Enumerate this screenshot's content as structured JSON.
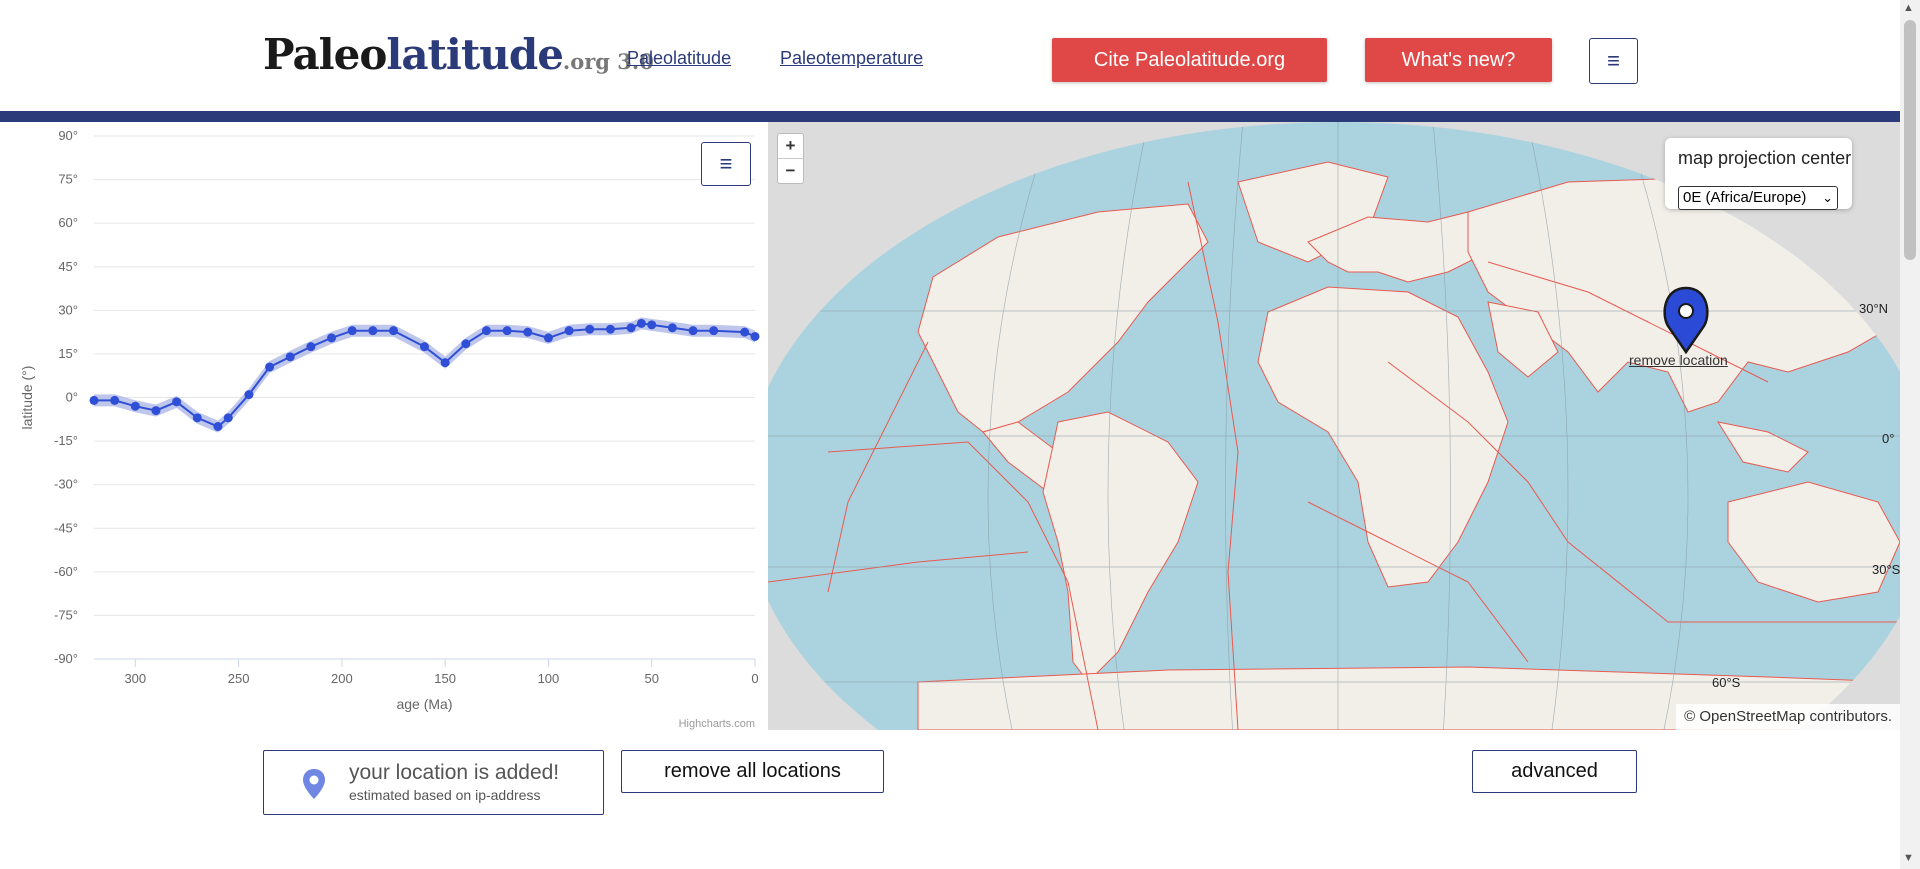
{
  "header": {
    "logo_main": "Paleo",
    "logo_accent": "latitude",
    "logo_suffix": ".org 3.0",
    "nav": [
      "Paleolatitude",
      "Paleotemperature"
    ],
    "cite_label": "Cite Paleolatitude.org",
    "whats_new_label": "What's new?",
    "menu_icon": "≡"
  },
  "map": {
    "zoom_in": "+",
    "zoom_out": "−",
    "projection_label": "map projection center",
    "projection_value": "0E (Africa/Europe)",
    "remove_location": "remove location",
    "attribution": "© OpenStreetMap contributors.",
    "grid_labels": [
      "30°N",
      "0°",
      "30°S",
      "60°S"
    ],
    "colors": {
      "ocean": "#abd3df",
      "land": "#f2efe9",
      "plates": "#e85a4f",
      "marker": "#2b4bd6"
    }
  },
  "chart_data": {
    "type": "line",
    "title": "",
    "xlabel": "age (Ma)",
    "ylabel": "latitude (°)",
    "credit": "Highcharts.com",
    "xlim": [
      320,
      0
    ],
    "ylim": [
      -90,
      90
    ],
    "xticks": [
      300,
      250,
      200,
      150,
      100,
      50,
      0
    ],
    "yticks": [
      "90°",
      "75°",
      "60°",
      "45°",
      "30°",
      "15°",
      "0°",
      "-15°",
      "-30°",
      "-45°",
      "-60°",
      "-75°",
      "-90°"
    ],
    "series": [
      {
        "x": [
          320,
          310,
          300,
          290,
          280,
          270,
          260,
          255,
          245,
          235,
          225,
          215,
          205,
          195,
          185,
          175,
          160,
          150,
          140,
          130,
          120,
          110,
          100,
          90,
          80,
          70,
          60,
          55,
          50,
          40,
          30,
          20,
          5,
          0
        ],
        "y": [
          -1,
          -1,
          -3,
          -4.5,
          -1.5,
          -7,
          -10,
          -7,
          1,
          10.5,
          14,
          17.5,
          20.5,
          23,
          23,
          23,
          17.5,
          12,
          18.5,
          23,
          23,
          22.5,
          20.5,
          23,
          23.5,
          23.5,
          24,
          25.5,
          25,
          24,
          23,
          23,
          22.5,
          21
        ]
      }
    ],
    "band_color": "#aab3e6",
    "line_color": "#2f4fd6"
  },
  "location": {
    "title": "your location is added!",
    "subtitle": "estimated based on ip-address",
    "remove_all_label": "remove all locations",
    "advanced_label": "advanced"
  }
}
